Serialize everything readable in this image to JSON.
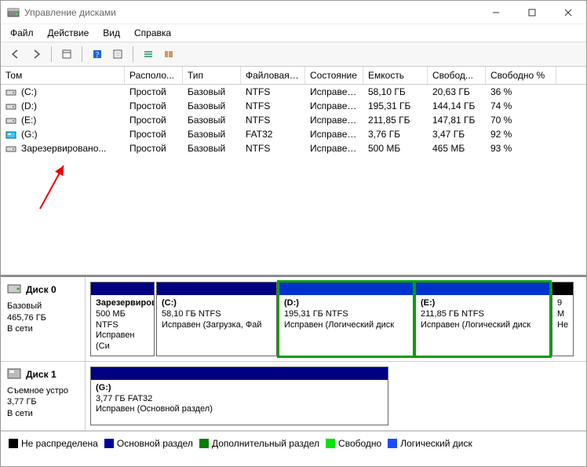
{
  "window": {
    "title": "Управление дисками"
  },
  "menu": {
    "file": "Файл",
    "action": "Действие",
    "view": "Вид",
    "help": "Справка"
  },
  "columns": {
    "volume": "Том",
    "layout": "Располо...",
    "type": "Тип",
    "fs": "Файловая с...",
    "status": "Состояние",
    "capacity": "Емкость",
    "free": "Свобод...",
    "pct": "Свободно %"
  },
  "volumes": [
    {
      "name": "(C:)",
      "icon": "drive",
      "layout": "Простой",
      "type": "Базовый",
      "fs": "NTFS",
      "status": "Исправен...",
      "capacity": "58,10 ГБ",
      "free": "20,63 ГБ",
      "pct": "36 %"
    },
    {
      "name": "(D:)",
      "icon": "drive",
      "layout": "Простой",
      "type": "Базовый",
      "fs": "NTFS",
      "status": "Исправен...",
      "capacity": "195,31 ГБ",
      "free": "144,14 ГБ",
      "pct": "74 %"
    },
    {
      "name": "(E:)",
      "icon": "drive",
      "layout": "Простой",
      "type": "Базовый",
      "fs": "NTFS",
      "status": "Исправен...",
      "capacity": "211,85 ГБ",
      "free": "147,81 ГБ",
      "pct": "70 %"
    },
    {
      "name": "(G:)",
      "icon": "removable",
      "layout": "Простой",
      "type": "Базовый",
      "fs": "FAT32",
      "status": "Исправен...",
      "capacity": "3,76 ГБ",
      "free": "3,47 ГБ",
      "pct": "92 %"
    },
    {
      "name": "Зарезервировано...",
      "icon": "drive",
      "layout": "Простой",
      "type": "Базовый",
      "fs": "NTFS",
      "status": "Исправен...",
      "capacity": "500 МБ",
      "free": "465 МБ",
      "pct": "93 %"
    }
  ],
  "disks": [
    {
      "title": "Диск 0",
      "type": "Базовый",
      "size": "465,76 ГБ",
      "state": "В сети",
      "icon": "disk",
      "partitions": [
        {
          "name": "Зарезервировано",
          "sub": "500 МБ NTFS",
          "status": "Исправен (Си",
          "hdr": "primary",
          "flex": "0 0 82px",
          "sel": false
        },
        {
          "name": "(C:)",
          "sub": "58,10 ГБ NTFS",
          "status": "Исправен (Загрузка, Фай",
          "hdr": "primary",
          "flex": "0 0 154px",
          "sel": false
        },
        {
          "name": "(D:)",
          "sub": "195,31 ГБ NTFS",
          "status": "Исправен (Логический диск",
          "hdr": "logical",
          "flex": "0 0 172px",
          "sel": true
        },
        {
          "name": "(E:)",
          "sub": "211,85 ГБ NTFS",
          "status": "Исправен (Логический диск",
          "hdr": "logical",
          "flex": "0 0 172px",
          "sel": true
        },
        {
          "name": "",
          "sub": "9 М",
          "status": "Не",
          "hdr": "black",
          "flex": "0 0 28px",
          "sel": false
        }
      ]
    },
    {
      "title": "Диск 1",
      "type": "Съемное устро",
      "size": "3,77 ГБ",
      "state": "В сети",
      "icon": "removable-disk",
      "partitions": [
        {
          "name": "(G:)",
          "sub": "3,77 ГБ FAT32",
          "status": "Исправен (Основной раздел)",
          "hdr": "primary",
          "flex": "0 0 380px",
          "sel": false
        }
      ]
    }
  ],
  "legend": {
    "unalloc": "Не распределена",
    "primary": "Основной раздел",
    "ext": "Дополнительный раздел",
    "free": "Свободно",
    "logical": "Логический диск"
  },
  "colors": {
    "unalloc": "#000000",
    "primary": "#000099",
    "ext": "#008000",
    "free": "#00e600",
    "logical": "#1a4dff"
  }
}
